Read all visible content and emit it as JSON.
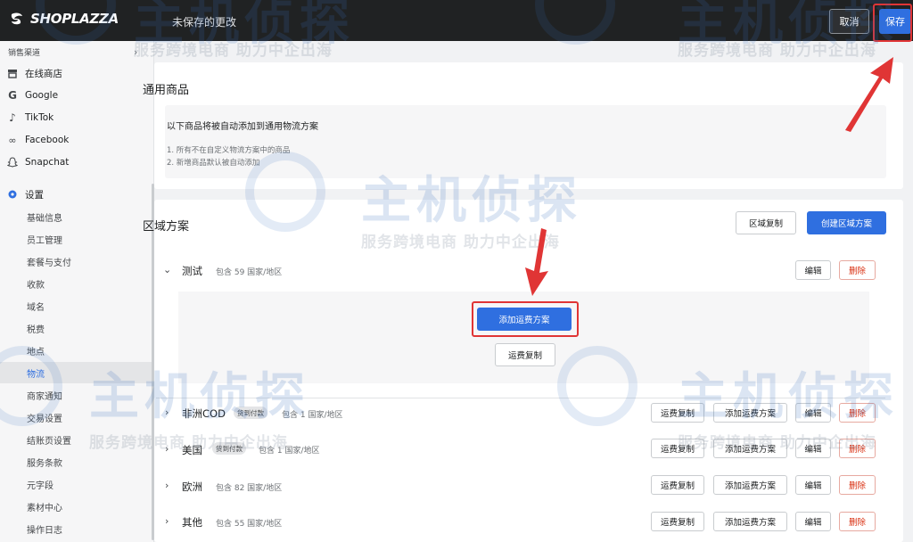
{
  "topbar": {
    "brand": "SHOPLAZZA",
    "unsaved": "未保存的更改",
    "cancel": "取消",
    "save": "保存"
  },
  "sidebar": {
    "section_label": "销售渠道",
    "channels": [
      {
        "label": "在线商店",
        "icon": "store-icon"
      },
      {
        "label": "Google",
        "icon": "google-icon"
      },
      {
        "label": "TikTok",
        "icon": "tiktok-icon"
      },
      {
        "label": "Facebook",
        "icon": "meta-icon"
      },
      {
        "label": "Snapchat",
        "icon": "snapchat-icon"
      }
    ],
    "settings_label": "设置",
    "sub_items": [
      "基础信息",
      "员工管理",
      "套餐与支付",
      "收款",
      "域名",
      "税费",
      "地点",
      "物流",
      "商家通知",
      "交易设置",
      "结账页设置",
      "服务条款",
      "元字段",
      "素材中心",
      "操作日志"
    ],
    "active": "物流"
  },
  "general": {
    "title": "通用商品",
    "desc": "以下商品将被自动添加到通用物流方案",
    "notes": [
      "1. 所有不在自定义物流方案中的商品",
      "2. 新增商品默认被自动添加"
    ]
  },
  "zones": {
    "title": "区域方案",
    "copy_button": "区域复制",
    "create_button": "创建区域方案",
    "edit": "编辑",
    "delete": "删除",
    "copy_fee": "运费复制",
    "add_fee": "添加运费方案",
    "expanded": {
      "name": "测试",
      "count": "包含 59 国家/地区"
    },
    "rows": [
      {
        "name": "非洲COD",
        "badge": "货到付款",
        "count": "包含 1 国家/地区"
      },
      {
        "name": "美国",
        "badge": "货到付款",
        "count": "包含 1 国家/地区"
      },
      {
        "name": "欧洲",
        "badge": "",
        "count": "包含 82 国家/地区"
      },
      {
        "name": "其他",
        "badge": "",
        "count": "包含 55 国家/地区"
      }
    ]
  },
  "watermark": {
    "brand": "主机侦探",
    "slogan": "服务跨境电商 助力中企出海"
  },
  "colors": {
    "primary": "#2f6fe0",
    "highlight": "#e03535",
    "topbar": "#202223"
  }
}
